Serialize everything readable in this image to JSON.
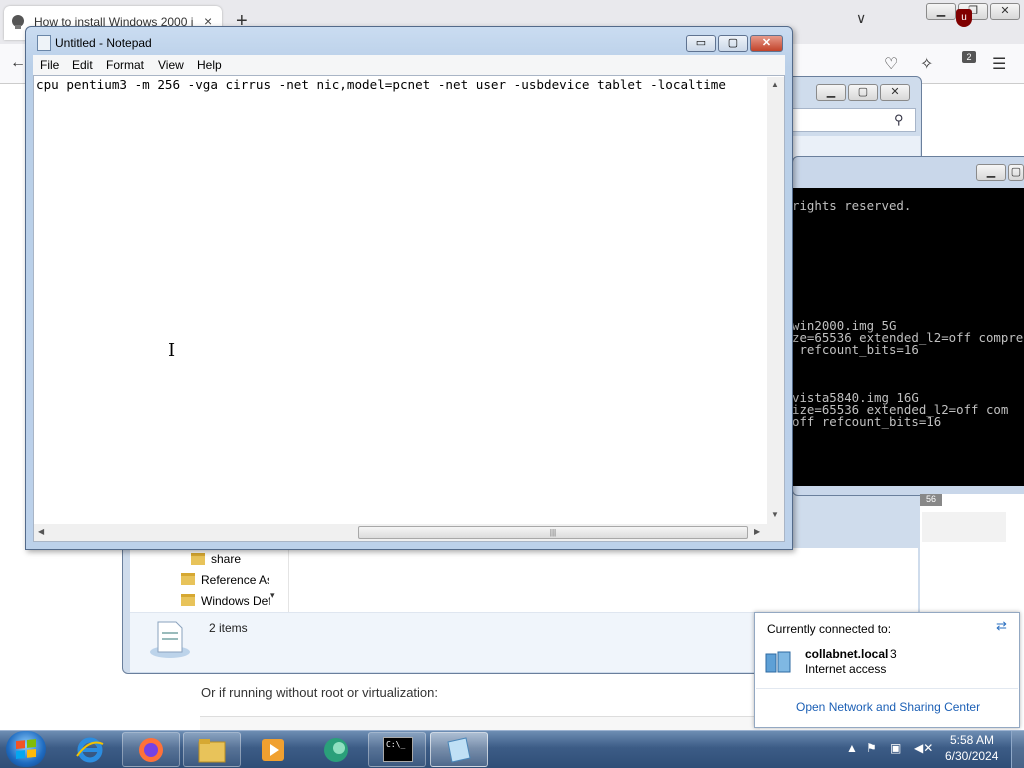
{
  "browser": {
    "tab_title": "How to install Windows 2000 i",
    "tab_close": "×",
    "new_tab": "+",
    "tabs_list": "∨",
    "ublock_badge": "2",
    "page_text": "Or if running without root or virtualization:"
  },
  "explorer": {
    "folders": [
      "share",
      "Reference As",
      "Windows Def"
    ],
    "status": "2 items"
  },
  "console": {
    "lines": [
      "rights reserved.",
      "win2000.img 5G",
      "ze=65536 extended_l2=off compre",
      " refcount_bits=16",
      "vista5840.img 16G",
      "ize=65536 extended_l2=off com",
      "off refcount_bits=16"
    ],
    "tag": "56"
  },
  "notepad": {
    "title": "Untitled - Notepad",
    "menu": [
      "File",
      "Edit",
      "Format",
      "View",
      "Help"
    ],
    "text": "cpu pentium3 -m 256 -vga cirrus -net nic,model=pcnet -net user -usbdevice tablet -localtime",
    "controls": {
      "minimize": "▭",
      "maximize": "▢",
      "close": "✕"
    }
  },
  "network_popup": {
    "header": "Currently connected to:",
    "network_name": "collabnet.local",
    "network_number": "3",
    "status": "Internet access",
    "link": "Open Network and Sharing Center"
  },
  "taskbar": {
    "apps": [
      "internet-explorer",
      "firefox",
      "file-explorer",
      "media-player",
      "network-app",
      "command-prompt",
      "notepad"
    ],
    "clock_time": "5:58 AM",
    "clock_date": "6/30/2024",
    "cmd_label": "C:\\_"
  },
  "colors": {
    "accent": "#1b5fb5",
    "close_red": "#c2432a",
    "console_bg": "#000000",
    "taskbar": "#3c5c86"
  }
}
